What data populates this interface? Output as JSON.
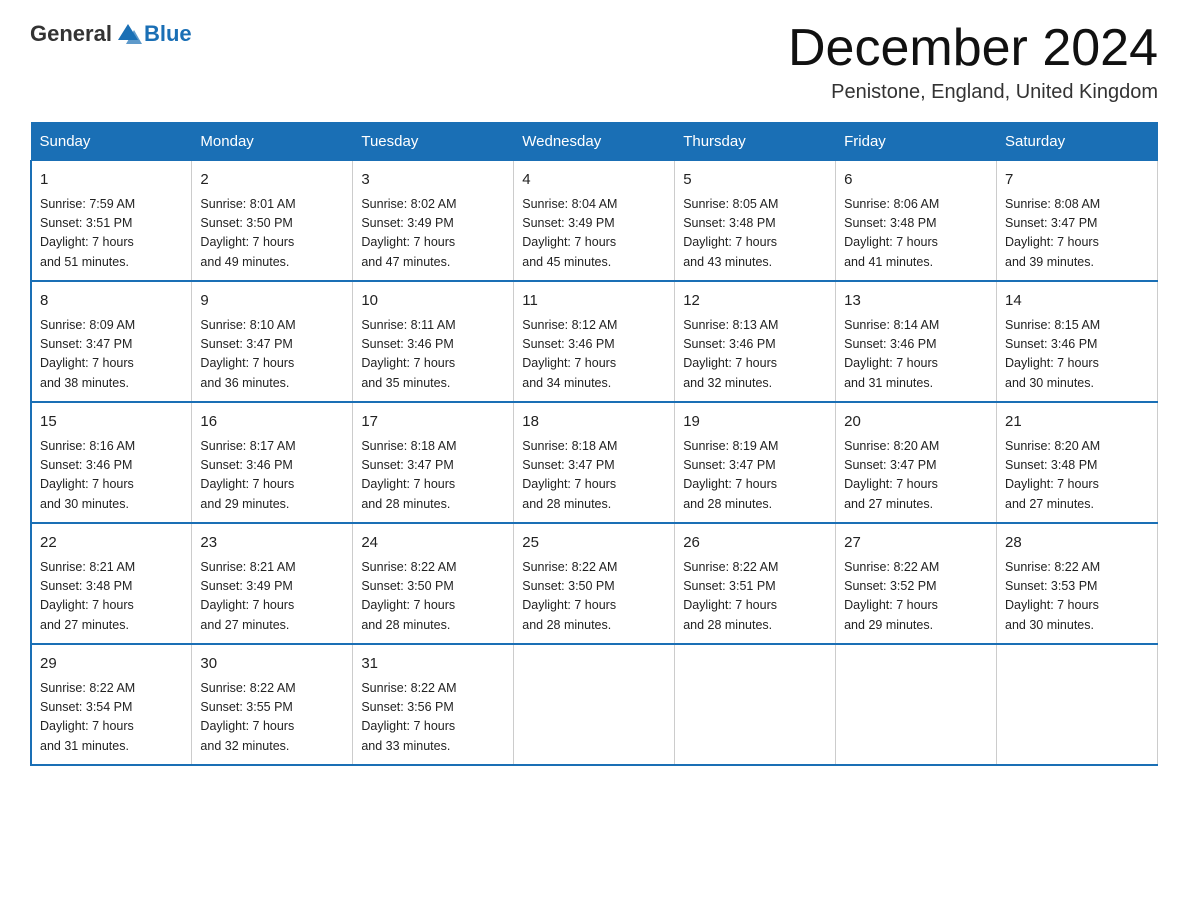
{
  "header": {
    "logo_general": "General",
    "logo_blue": "Blue",
    "title": "December 2024",
    "location": "Penistone, England, United Kingdom"
  },
  "days_of_week": [
    "Sunday",
    "Monday",
    "Tuesday",
    "Wednesday",
    "Thursday",
    "Friday",
    "Saturday"
  ],
  "weeks": [
    [
      {
        "day": "1",
        "sunrise": "7:59 AM",
        "sunset": "3:51 PM",
        "daylight": "7 hours and 51 minutes."
      },
      {
        "day": "2",
        "sunrise": "8:01 AM",
        "sunset": "3:50 PM",
        "daylight": "7 hours and 49 minutes."
      },
      {
        "day": "3",
        "sunrise": "8:02 AM",
        "sunset": "3:49 PM",
        "daylight": "7 hours and 47 minutes."
      },
      {
        "day": "4",
        "sunrise": "8:04 AM",
        "sunset": "3:49 PM",
        "daylight": "7 hours and 45 minutes."
      },
      {
        "day": "5",
        "sunrise": "8:05 AM",
        "sunset": "3:48 PM",
        "daylight": "7 hours and 43 minutes."
      },
      {
        "day": "6",
        "sunrise": "8:06 AM",
        "sunset": "3:48 PM",
        "daylight": "7 hours and 41 minutes."
      },
      {
        "day": "7",
        "sunrise": "8:08 AM",
        "sunset": "3:47 PM",
        "daylight": "7 hours and 39 minutes."
      }
    ],
    [
      {
        "day": "8",
        "sunrise": "8:09 AM",
        "sunset": "3:47 PM",
        "daylight": "7 hours and 38 minutes."
      },
      {
        "day": "9",
        "sunrise": "8:10 AM",
        "sunset": "3:47 PM",
        "daylight": "7 hours and 36 minutes."
      },
      {
        "day": "10",
        "sunrise": "8:11 AM",
        "sunset": "3:46 PM",
        "daylight": "7 hours and 35 minutes."
      },
      {
        "day": "11",
        "sunrise": "8:12 AM",
        "sunset": "3:46 PM",
        "daylight": "7 hours and 34 minutes."
      },
      {
        "day": "12",
        "sunrise": "8:13 AM",
        "sunset": "3:46 PM",
        "daylight": "7 hours and 32 minutes."
      },
      {
        "day": "13",
        "sunrise": "8:14 AM",
        "sunset": "3:46 PM",
        "daylight": "7 hours and 31 minutes."
      },
      {
        "day": "14",
        "sunrise": "8:15 AM",
        "sunset": "3:46 PM",
        "daylight": "7 hours and 30 minutes."
      }
    ],
    [
      {
        "day": "15",
        "sunrise": "8:16 AM",
        "sunset": "3:46 PM",
        "daylight": "7 hours and 30 minutes."
      },
      {
        "day": "16",
        "sunrise": "8:17 AM",
        "sunset": "3:46 PM",
        "daylight": "7 hours and 29 minutes."
      },
      {
        "day": "17",
        "sunrise": "8:18 AM",
        "sunset": "3:47 PM",
        "daylight": "7 hours and 28 minutes."
      },
      {
        "day": "18",
        "sunrise": "8:18 AM",
        "sunset": "3:47 PM",
        "daylight": "7 hours and 28 minutes."
      },
      {
        "day": "19",
        "sunrise": "8:19 AM",
        "sunset": "3:47 PM",
        "daylight": "7 hours and 28 minutes."
      },
      {
        "day": "20",
        "sunrise": "8:20 AM",
        "sunset": "3:47 PM",
        "daylight": "7 hours and 27 minutes."
      },
      {
        "day": "21",
        "sunrise": "8:20 AM",
        "sunset": "3:48 PM",
        "daylight": "7 hours and 27 minutes."
      }
    ],
    [
      {
        "day": "22",
        "sunrise": "8:21 AM",
        "sunset": "3:48 PM",
        "daylight": "7 hours and 27 minutes."
      },
      {
        "day": "23",
        "sunrise": "8:21 AM",
        "sunset": "3:49 PM",
        "daylight": "7 hours and 27 minutes."
      },
      {
        "day": "24",
        "sunrise": "8:22 AM",
        "sunset": "3:50 PM",
        "daylight": "7 hours and 28 minutes."
      },
      {
        "day": "25",
        "sunrise": "8:22 AM",
        "sunset": "3:50 PM",
        "daylight": "7 hours and 28 minutes."
      },
      {
        "day": "26",
        "sunrise": "8:22 AM",
        "sunset": "3:51 PM",
        "daylight": "7 hours and 28 minutes."
      },
      {
        "day": "27",
        "sunrise": "8:22 AM",
        "sunset": "3:52 PM",
        "daylight": "7 hours and 29 minutes."
      },
      {
        "day": "28",
        "sunrise": "8:22 AM",
        "sunset": "3:53 PM",
        "daylight": "7 hours and 30 minutes."
      }
    ],
    [
      {
        "day": "29",
        "sunrise": "8:22 AM",
        "sunset": "3:54 PM",
        "daylight": "7 hours and 31 minutes."
      },
      {
        "day": "30",
        "sunrise": "8:22 AM",
        "sunset": "3:55 PM",
        "daylight": "7 hours and 32 minutes."
      },
      {
        "day": "31",
        "sunrise": "8:22 AM",
        "sunset": "3:56 PM",
        "daylight": "7 hours and 33 minutes."
      },
      null,
      null,
      null,
      null
    ]
  ]
}
